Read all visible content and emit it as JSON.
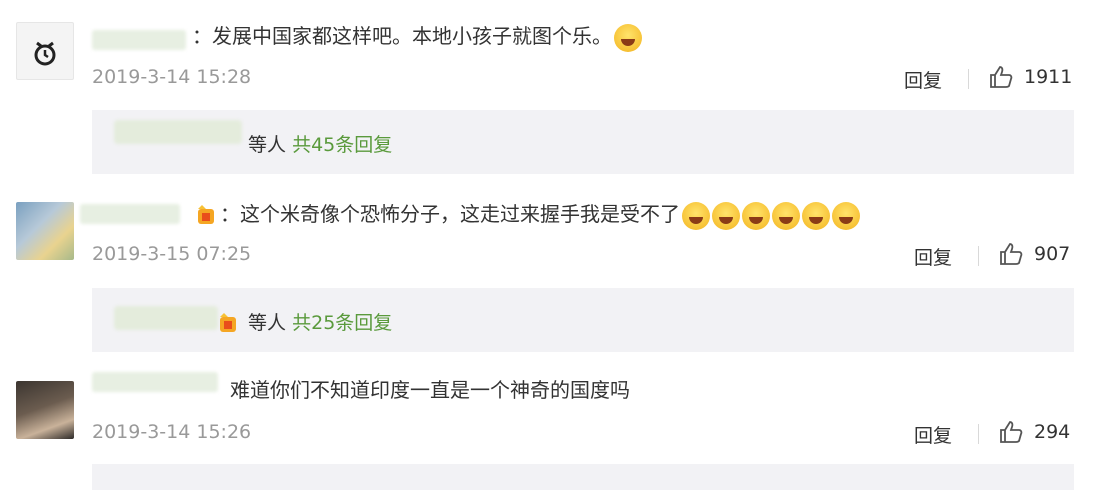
{
  "comments": [
    {
      "text": "：发展中国家都这样吧。本地小孩子就图个乐。",
      "time": "2019-3-14 15:28",
      "reply_label": "回复",
      "likes": "1911",
      "sub": {
        "prefix": "等人",
        "link": "共45条回复"
      }
    },
    {
      "text": "：这个米奇像个恐怖分子，这走过来握手我是受不了",
      "time": "2019-3-15 07:25",
      "reply_label": "回复",
      "likes": "907",
      "sub": {
        "prefix": "等人",
        "link": "共25条回复"
      }
    },
    {
      "text": "难道你们不知道印度一直是一个神奇的国度吗",
      "time": "2019-3-14 15:26",
      "reply_label": "回复",
      "likes": "294"
    }
  ],
  "colors": {
    "link": "#5a9a3c",
    "time": "#999999",
    "subpanel": "#f2f2f5"
  },
  "icons": [
    "clock-avatar-icon",
    "laugh-cry-emoji-icon",
    "vip-badge-icon",
    "thumbs-up-icon"
  ]
}
